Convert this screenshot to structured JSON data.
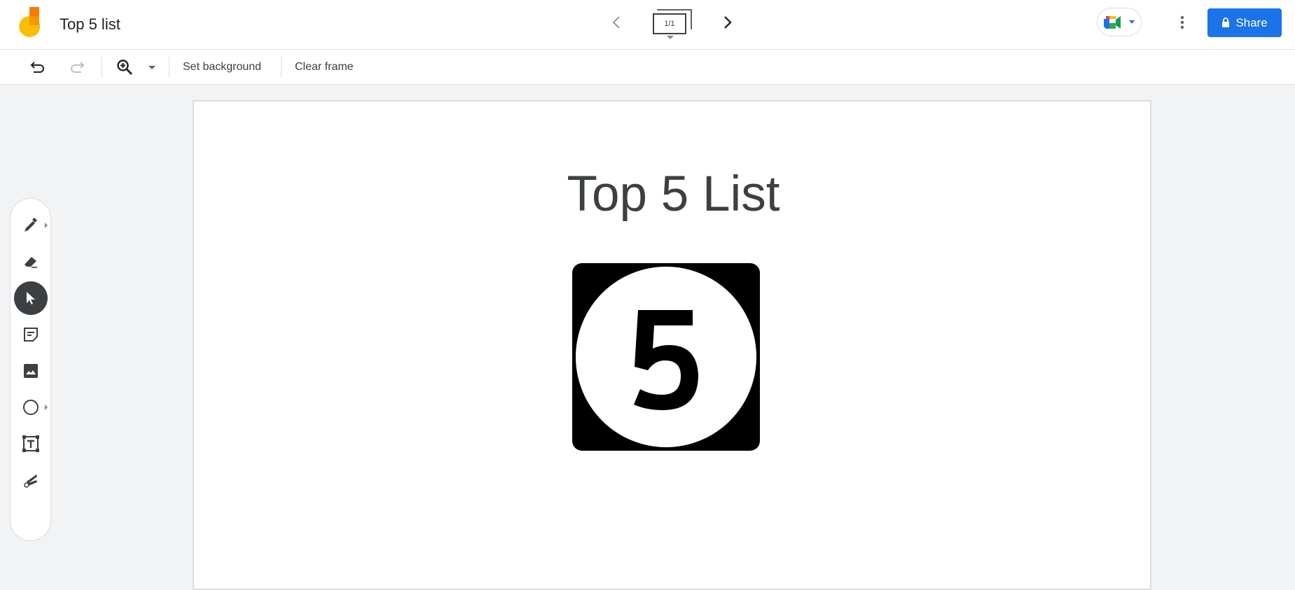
{
  "app": {
    "title": "Top 5 list",
    "logo_icon": "jamboard-logo-icon"
  },
  "header": {
    "prev_frame_icon": "chevron-left-icon",
    "next_frame_icon": "chevron-right-icon",
    "frame_counter": "1/1",
    "frames_icon": "frames-icon",
    "meet_icon": "google-meet-icon",
    "more_icon": "more-vertical-icon",
    "share_label": "Share",
    "share_icon": "lock-icon",
    "accent_color": "#1a73e8"
  },
  "toolbar": {
    "undo_icon": "undo-icon",
    "redo_icon": "redo-icon",
    "zoom_icon": "zoom-in-icon",
    "zoom_dropdown_icon": "caret-down-icon",
    "set_background_label": "Set background",
    "clear_frame_label": "Clear frame"
  },
  "tools": [
    {
      "name": "Pen",
      "icon": "pen-icon",
      "has_submenu": true,
      "active": false
    },
    {
      "name": "Eraser",
      "icon": "eraser-icon",
      "has_submenu": false,
      "active": false
    },
    {
      "name": "Select",
      "icon": "cursor-icon",
      "has_submenu": false,
      "active": true
    },
    {
      "name": "Sticky note",
      "icon": "sticky-note-icon",
      "has_submenu": false,
      "active": false
    },
    {
      "name": "Add image",
      "icon": "image-icon",
      "has_submenu": false,
      "active": false
    },
    {
      "name": "Circle",
      "icon": "circle-icon",
      "has_submenu": true,
      "active": false
    },
    {
      "name": "Text box",
      "icon": "text-box-icon",
      "has_submenu": false,
      "active": false
    },
    {
      "name": "Laser",
      "icon": "laser-icon",
      "has_submenu": false,
      "active": false
    }
  ],
  "canvas": {
    "title": "Top 5 List",
    "image_number": "5"
  }
}
